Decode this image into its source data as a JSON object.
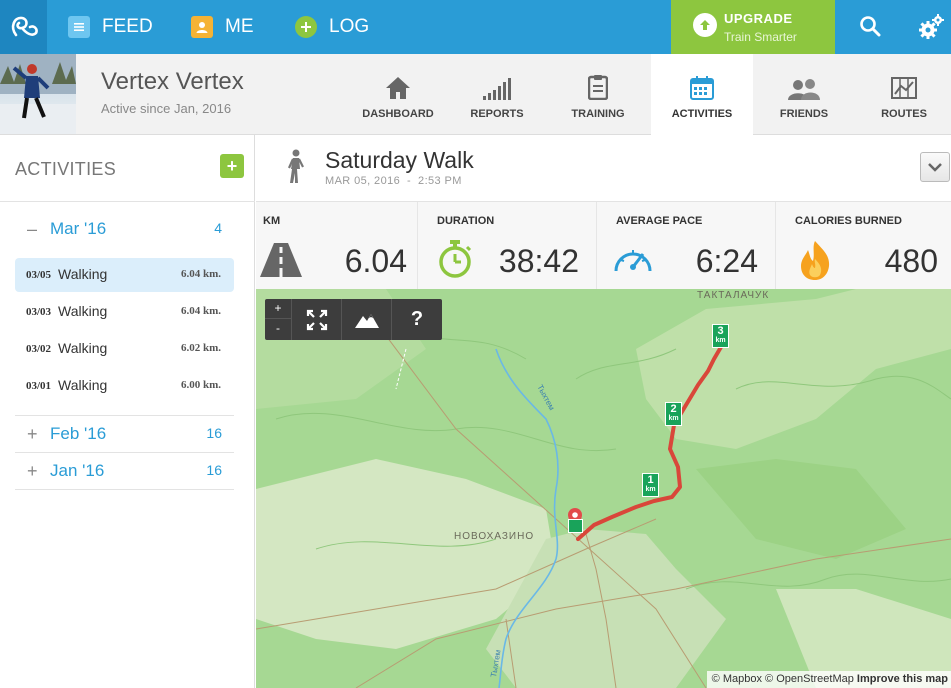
{
  "topbar": {
    "nav": [
      {
        "label": "FEED",
        "icon": "feed-icon"
      },
      {
        "label": "ME",
        "icon": "person-icon"
      },
      {
        "label": "LOG",
        "icon": "plus-circle-icon"
      }
    ],
    "upgrade": {
      "title": "UPGRADE",
      "subtitle": "Train Smarter"
    },
    "icons": [
      "logo-icon",
      "search-icon",
      "gear-icon"
    ]
  },
  "profile": {
    "name": "Vertex Vertex",
    "active_since": "Active since Jan, 2016"
  },
  "tabs": [
    {
      "label": "DASHBOARD",
      "icon": "home-icon"
    },
    {
      "label": "REPORTS",
      "icon": "bar-chart-icon"
    },
    {
      "label": "TRAINING",
      "icon": "clipboard-icon"
    },
    {
      "label": "ACTIVITIES",
      "icon": "calendar-icon",
      "active": true
    },
    {
      "label": "FRIENDS",
      "icon": "friends-icon"
    },
    {
      "label": "ROUTES",
      "icon": "map-icon"
    }
  ],
  "sidebar": {
    "title": "ACTIVITIES",
    "add_label": "+",
    "months": [
      {
        "sign": "–",
        "name": "Mar '16",
        "count": "4"
      },
      {
        "sign": "+",
        "name": "Feb '16",
        "count": "16"
      },
      {
        "sign": "+",
        "name": "Jan '16",
        "count": "16"
      }
    ],
    "activities": [
      {
        "date": "03/05",
        "name": "Walking",
        "km": "6.04 km.",
        "selected": true
      },
      {
        "date": "03/03",
        "name": "Walking",
        "km": "6.04 km."
      },
      {
        "date": "03/02",
        "name": "Walking",
        "km": "6.02 km."
      },
      {
        "date": "03/01",
        "name": "Walking",
        "km": "6.00 km."
      }
    ]
  },
  "activity": {
    "title": "Saturday Walk",
    "date": "MAR 05, 2016",
    "separator": "-",
    "time": "2:53 PM"
  },
  "stats": [
    {
      "label": "KM",
      "value": "6.04",
      "icon": "road-icon"
    },
    {
      "label": "DURATION",
      "value": "38:42",
      "icon": "stopwatch-icon"
    },
    {
      "label": "AVERAGE PACE",
      "value": "6:24",
      "icon": "speedometer-icon"
    },
    {
      "label": "CALORIES BURNED",
      "value": "480",
      "icon": "flame-icon"
    }
  ],
  "map": {
    "controls": {
      "zoom_in": "+",
      "zoom_out": "-",
      "help": "?"
    },
    "labels": [
      "ТАКТАЛАЧУК",
      "НОВОХАЗИНО",
      "Тыхтем",
      "Тыхтем"
    ],
    "km_markers": [
      {
        "num": "1",
        "unit": "km"
      },
      {
        "num": "2",
        "unit": "km"
      },
      {
        "num": "3",
        "unit": "km"
      }
    ],
    "attribution": {
      "mapbox": "© Mapbox",
      "osm": "© OpenStreetMap",
      "improve": "Improve this map"
    }
  },
  "colors": {
    "primary": "#2a9cd6",
    "accent": "#8dc63f",
    "route": "#d9473a"
  }
}
